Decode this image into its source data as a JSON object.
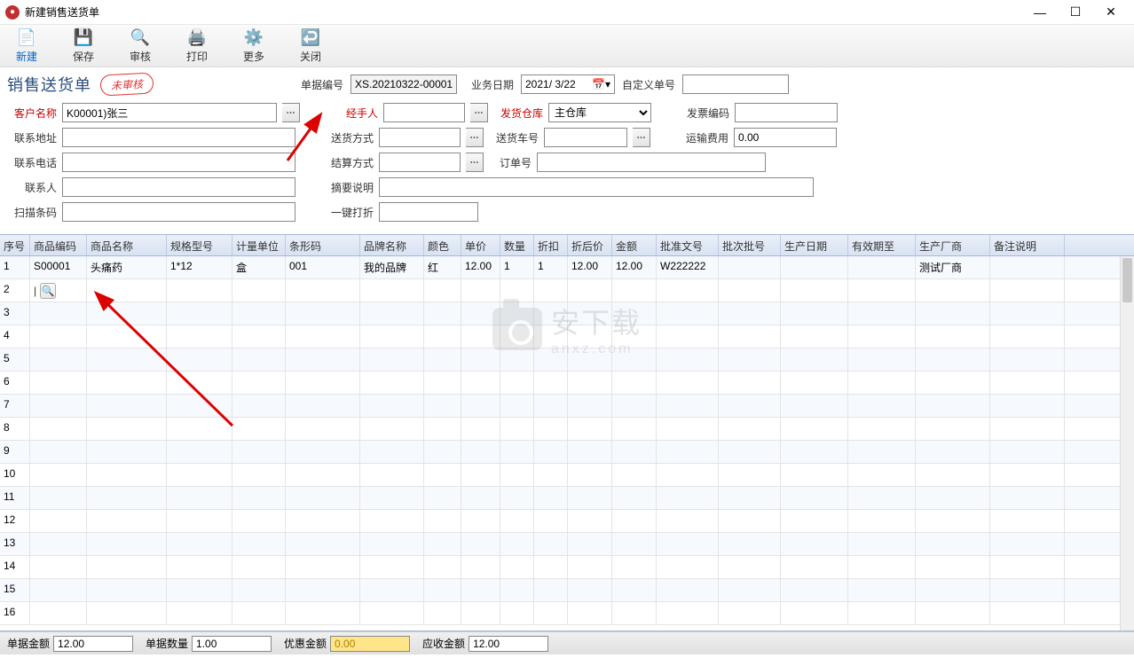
{
  "window": {
    "title": "新建销售送货单"
  },
  "toolbar": {
    "new": "新建",
    "save": "保存",
    "audit": "审核",
    "print": "打印",
    "more": "更多",
    "close": "关闭"
  },
  "header": {
    "title": "销售送货单",
    "stamp": "未审核",
    "doc_no_label": "单据编号",
    "doc_no": "XS.20210322-00001",
    "biz_date_label": "业务日期",
    "biz_date": "2021/ 3/22",
    "custom_no_label": "自定义单号",
    "custom_no": ""
  },
  "form": {
    "customer_label": "客户名称",
    "customer": "K00001)张三",
    "handler_label": "经手人",
    "handler": "",
    "warehouse_label": "发货仓库",
    "warehouse": "主仓库",
    "invoice_no_label": "发票编码",
    "invoice_no": "",
    "address_label": "联系地址",
    "address": "",
    "ship_method_label": "送货方式",
    "ship_method": "",
    "vehicle_no_label": "送货车号",
    "vehicle_no": "",
    "freight_label": "运输费用",
    "freight": "0.00",
    "phone_label": "联系电话",
    "phone": "",
    "settle_label": "结算方式",
    "settle": "",
    "order_no_label": "订单号",
    "order_no": "",
    "contact_label": "联系人",
    "contact": "",
    "summary_label": "摘要说明",
    "summary": "",
    "barcode_label": "扫描条码",
    "barcode": "",
    "discount_label": "一键打折",
    "discount": ""
  },
  "grid": {
    "cols": [
      "序号",
      "商品编码",
      "商品名称",
      "规格型号",
      "计量单位",
      "条形码",
      "品牌名称",
      "颜色",
      "单价",
      "数量",
      "折扣",
      "折后价",
      "金额",
      "批准文号",
      "批次批号",
      "生产日期",
      "有效期至",
      "生产厂商",
      "备注说明"
    ],
    "rows": [
      {
        "n": "1",
        "code": "S00001",
        "name": "头痛药",
        "spec": "1*12",
        "unit": "盒",
        "barcode": "001",
        "brand": "我的品牌",
        "color": "红",
        "price": "12.00",
        "qty": "1",
        "disc": "1",
        "net": "12.00",
        "amt": "12.00",
        "apno": "W222222",
        "batch": "",
        "pdate": "",
        "exp": "",
        "mfr": "测试厂商",
        "remark": ""
      },
      {
        "n": "2",
        "code": "",
        "name": "",
        "spec": "",
        "unit": "",
        "barcode": "",
        "brand": "",
        "color": "",
        "price": "",
        "qty": "",
        "disc": "",
        "net": "",
        "amt": "",
        "apno": "",
        "batch": "",
        "pdate": "",
        "exp": "",
        "mfr": "",
        "remark": ""
      }
    ],
    "blank_rows": 14
  },
  "footer": {
    "amount_label": "单据金额",
    "amount": "12.00",
    "qty_label": "单据数量",
    "qty": "1.00",
    "discount_amt_label": "优惠金额",
    "discount_amt": "0.00",
    "receivable_label": "应收金额",
    "receivable": "12.00"
  },
  "watermark": {
    "big": "安下载",
    "small": "anxz.com"
  }
}
